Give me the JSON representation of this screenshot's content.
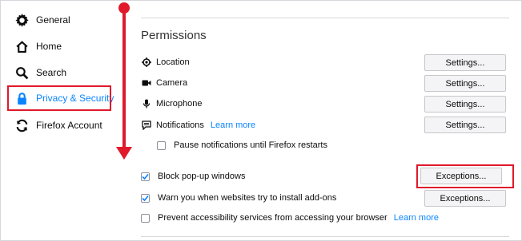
{
  "sidebar": {
    "items": [
      {
        "label": "General",
        "icon": "gear-icon"
      },
      {
        "label": "Home",
        "icon": "home-icon"
      },
      {
        "label": "Search",
        "icon": "search-icon"
      },
      {
        "label": "Privacy & Security",
        "icon": "lock-icon",
        "selected": true
      },
      {
        "label": "Firefox Account",
        "icon": "sync-icon"
      }
    ]
  },
  "permissions": {
    "title": "Permissions",
    "rows": [
      {
        "label": "Location",
        "icon": "location-icon",
        "button": "Settings..."
      },
      {
        "label": "Camera",
        "icon": "camera-icon",
        "button": "Settings..."
      },
      {
        "label": "Microphone",
        "icon": "microphone-icon",
        "button": "Settings..."
      },
      {
        "label": "Notifications",
        "icon": "notifications-icon",
        "link": "Learn more",
        "button": "Settings..."
      }
    ],
    "pause_notifications": {
      "label": "Pause notifications until Firefox restarts",
      "checked": false
    },
    "block_popups": {
      "label": "Block pop-up windows",
      "checked": true,
      "button": "Exceptions..."
    },
    "warn_addons": {
      "label": "Warn you when websites try to install add-ons",
      "checked": true,
      "button": "Exceptions..."
    },
    "accessibility": {
      "label": "Prevent accessibility services from accessing your browser",
      "checked": false,
      "link": "Learn more"
    }
  },
  "colors": {
    "accent": "#0a84ff",
    "annotation": "#e0192b",
    "text": "#0c0c0d"
  }
}
